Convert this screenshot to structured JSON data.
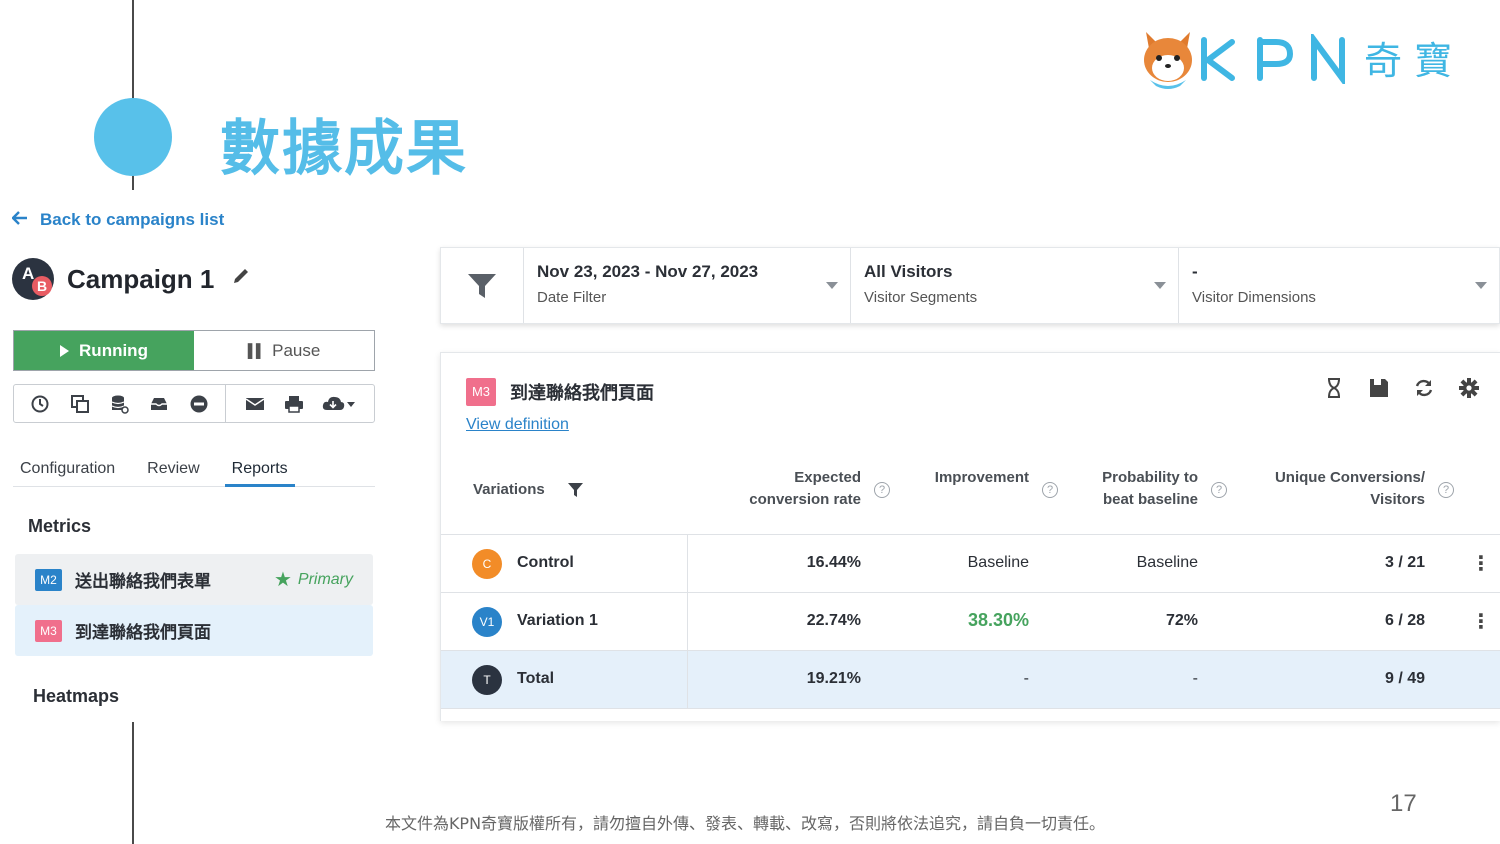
{
  "slide": {
    "title": "數據成果",
    "logo_text": "KPN奇寶",
    "footer": "本文件為KPN奇寶版權所有，請勿擅自外傳、發表、轉載、改寫，否則將依法追究，請自負一切責任。",
    "page_number": "17",
    "accent_color": "#55bde8"
  },
  "nav": {
    "back_label": "Back to campaigns list"
  },
  "campaign": {
    "avatar_a": "A",
    "avatar_b": "B",
    "name": "Campaign 1",
    "status_running": "Running",
    "status_pause": "Pause"
  },
  "toolbar": {
    "icons": [
      "history-icon",
      "duplicate-icon",
      "database-icon",
      "archive-icon",
      "stop-icon",
      "mail-icon",
      "print-icon",
      "cloud-download-icon"
    ]
  },
  "tabs": [
    "Configuration",
    "Review",
    "Reports"
  ],
  "metrics": {
    "title": "Metrics",
    "items": [
      {
        "badge": "M2",
        "name": "送出聯絡我們表單",
        "tag": "Primary"
      },
      {
        "badge": "M3",
        "name": "到達聯絡我們頁面"
      }
    ],
    "heatmaps_title": "Heatmaps"
  },
  "filters": [
    {
      "value": "Nov 23, 2023 - Nov 27, 2023",
      "label": "Date Filter"
    },
    {
      "value": "All Visitors",
      "label": "Visitor Segments"
    },
    {
      "value": "-",
      "label": "Visitor Dimensions"
    }
  ],
  "report": {
    "badge": "M3",
    "title": "到達聯絡我們頁面",
    "view_definition": "View definition",
    "headers": {
      "variations": "Variations",
      "expected_1": "Expected",
      "expected_2": "conversion rate",
      "improvement": "Improvement",
      "probability_1": "Probability to",
      "probability_2": "beat baseline",
      "unique_1": "Unique Conversions/",
      "unique_2": "Visitors",
      "help": "?"
    },
    "rows": [
      {
        "badge": "C",
        "color": "#f28c28",
        "name": "Control",
        "expected": "16.44%",
        "improvement": "Baseline",
        "probability": "Baseline",
        "conversions": "3 / 21"
      },
      {
        "badge": "V1",
        "color": "#2a83c9",
        "name": "Variation 1",
        "expected": "22.74%",
        "improvement": "38.30%",
        "probability": "72%",
        "conversions": "6 / 28"
      },
      {
        "badge": "T",
        "color": "#2b3340",
        "name": "Total",
        "expected": "19.21%",
        "improvement": "-",
        "probability": "-",
        "conversions": "9 / 49"
      }
    ]
  }
}
